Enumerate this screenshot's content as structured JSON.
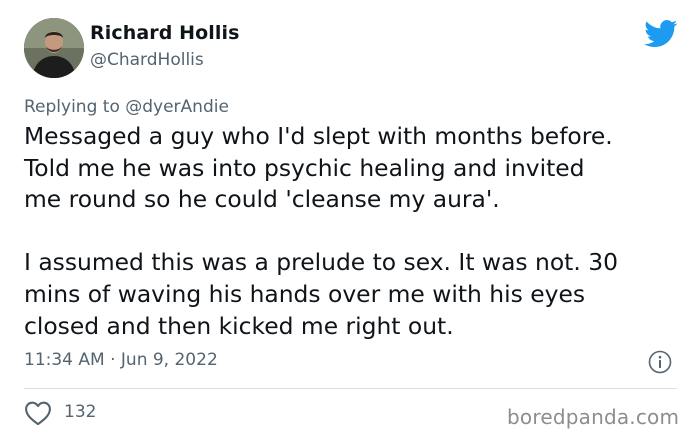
{
  "author": {
    "display_name": "Richard Hollis",
    "handle": "@ChardHollis"
  },
  "reply": {
    "prefix": "Replying to",
    "mention": "@dyerAndie"
  },
  "tweet": {
    "paragraph1_lines": [
      "Messaged a guy who I'd slept with months before.",
      "Told me he was into psychic healing and invited",
      "me round so he could 'cleanse my aura'."
    ],
    "paragraph2_lines": [
      "I assumed this was a prelude to sex. It was not. 30",
      "mins of waving his hands over me with his eyes",
      "closed and then kicked me right out."
    ]
  },
  "timestamp": "11:34 AM · Jun 9, 2022",
  "likes": {
    "count": "132"
  },
  "watermark": "boredpanda.com",
  "colors": {
    "twitter_blue": "#1d9bf0",
    "secondary_text": "#536471",
    "primary_text": "#0f1419",
    "divider": "#d8dee3"
  },
  "icons": [
    "twitter-bird-icon",
    "info-icon",
    "heart-icon"
  ]
}
